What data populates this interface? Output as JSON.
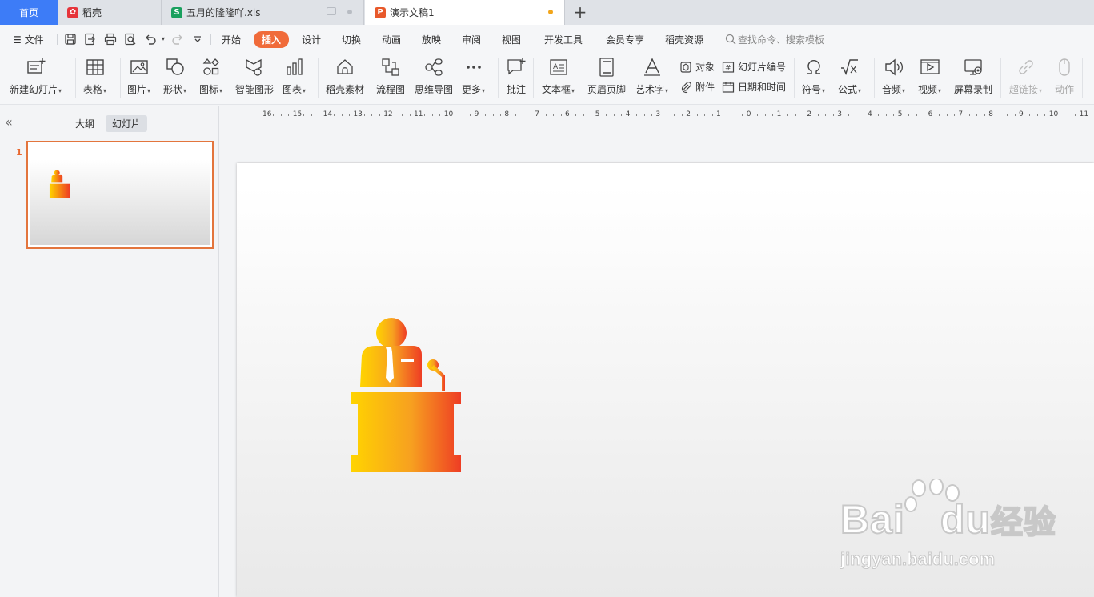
{
  "tabs": {
    "home": "首页",
    "docer": "稻壳",
    "xls": "五月的隆隆吖.xls",
    "ppt": "演示文稿1",
    "add": "+"
  },
  "menu": {
    "file": "文件",
    "items": [
      "开始",
      "插入",
      "设计",
      "切换",
      "动画",
      "放映",
      "审阅",
      "视图",
      "开发工具",
      "会员专享",
      "稻壳资源"
    ],
    "active": "插入",
    "search": "查找命令、搜索模板"
  },
  "ribbon": {
    "new_slide": "新建幻灯片",
    "table": "表格",
    "picture": "图片",
    "shape": "形状",
    "icon": "图标",
    "smartart": "智能图形",
    "chart": "图表",
    "docer_material": "稻壳素材",
    "flowchart": "流程图",
    "mindmap": "思维导图",
    "more": "更多",
    "comment": "批注",
    "textbox": "文本框",
    "header_footer": "页眉页脚",
    "wordart": "艺术字",
    "object": "对象",
    "attachment": "附件",
    "slide_number": "幻灯片编号",
    "datetime": "日期和时间",
    "symbol": "符号",
    "formula": "公式",
    "audio": "音频",
    "video": "视频",
    "screen_record": "屏幕录制",
    "hyperlink": "超链接",
    "action": "动作"
  },
  "panel": {
    "outline": "大纲",
    "slides": "幻灯片",
    "slide_number": "1"
  },
  "ruler": {
    "left": [
      "16",
      "15",
      "14",
      "13",
      "12",
      "11",
      "10",
      "9",
      "8",
      "7",
      "6",
      "5",
      "4",
      "3",
      "2",
      "1",
      "0"
    ],
    "right": [
      "1",
      "2",
      "3",
      "4",
      "5",
      "6",
      "7",
      "8",
      "9",
      "10",
      "11"
    ]
  },
  "watermark": {
    "brand": "Bai",
    "brand2": "du",
    "cn": "经验",
    "url": "jingyan.baidu.com"
  },
  "colors": {
    "accent": "#f06b3a",
    "home_tab": "#3d7cf7",
    "podium_start": "#ffd400",
    "podium_end": "#ee3d24"
  }
}
